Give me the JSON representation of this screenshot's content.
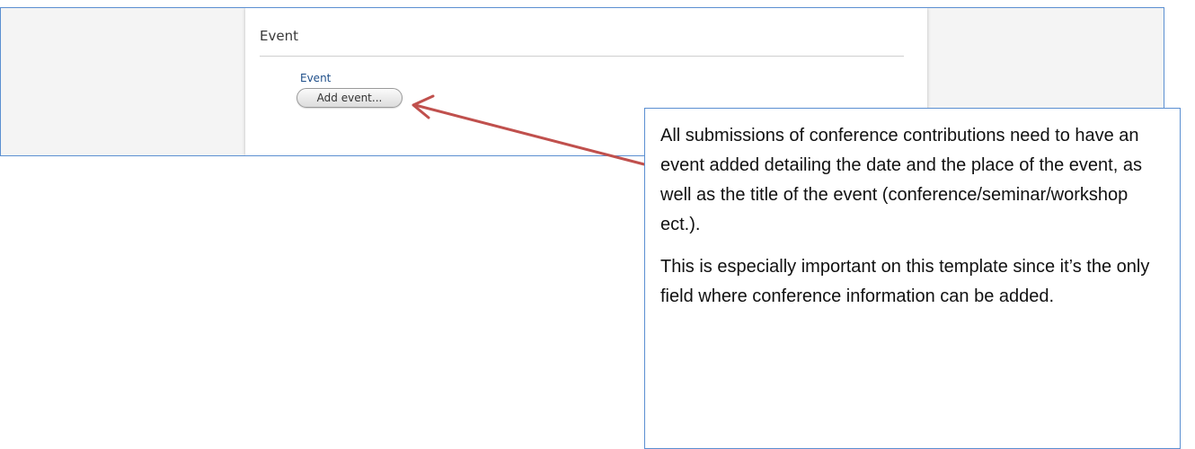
{
  "event_section": {
    "title": "Event",
    "field_label": "Event",
    "add_button_label": "Add event..."
  },
  "callout": {
    "paragraph_1": "All submissions of conference contributions need to have an event added detailing the date and the place of the event, as well as the title of the event (conference/seminar/workshop ect.).",
    "paragraph_2": "This is especially important on this template since it’s the only field where conference information can be added."
  },
  "colors": {
    "frame_border": "#5b8fd1",
    "arrow": "#c0504d",
    "field_label": "#1f4f8a"
  }
}
